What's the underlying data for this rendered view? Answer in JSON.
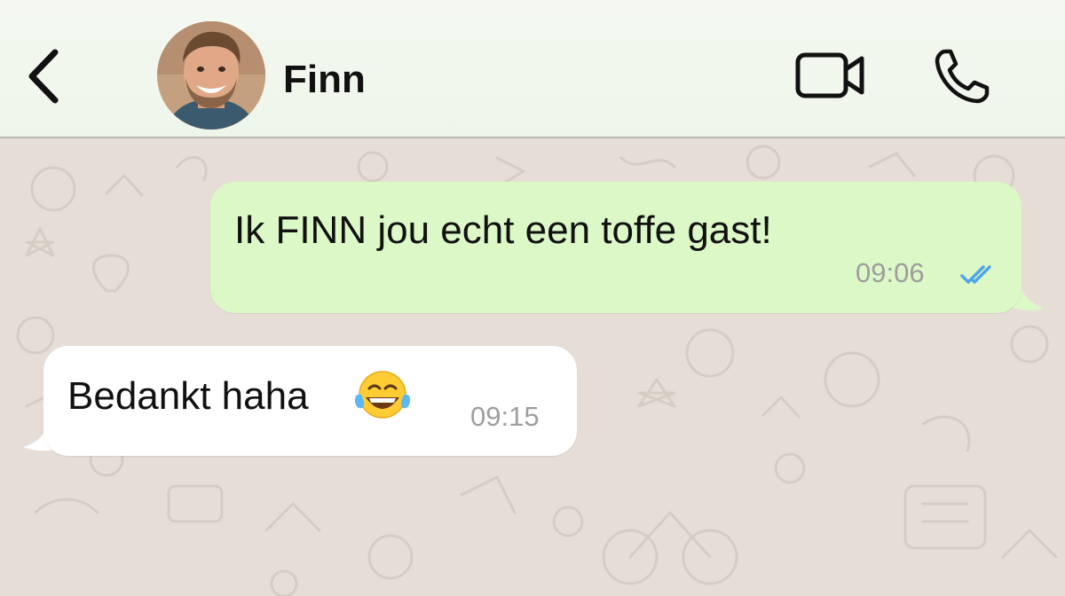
{
  "header": {
    "contact_name": "Finn"
  },
  "icons": {
    "back": "chevron-left-icon",
    "video": "video-camera-icon",
    "call": "phone-icon",
    "read_receipt": "double-check-icon",
    "emoji": "face-with-tears-of-joy"
  },
  "messages": [
    {
      "direction": "outgoing",
      "text": "Ik FINN jou echt een toffe gast!",
      "time": "09:06",
      "status": "read"
    },
    {
      "direction": "incoming",
      "text": "Bedankt haha",
      "time": "09:15"
    }
  ],
  "colors": {
    "outgoing_bubble": "#dcf8c7",
    "incoming_bubble": "#ffffff",
    "read_ticks": "#4fa7e6",
    "chat_background": "#e6ded6"
  }
}
